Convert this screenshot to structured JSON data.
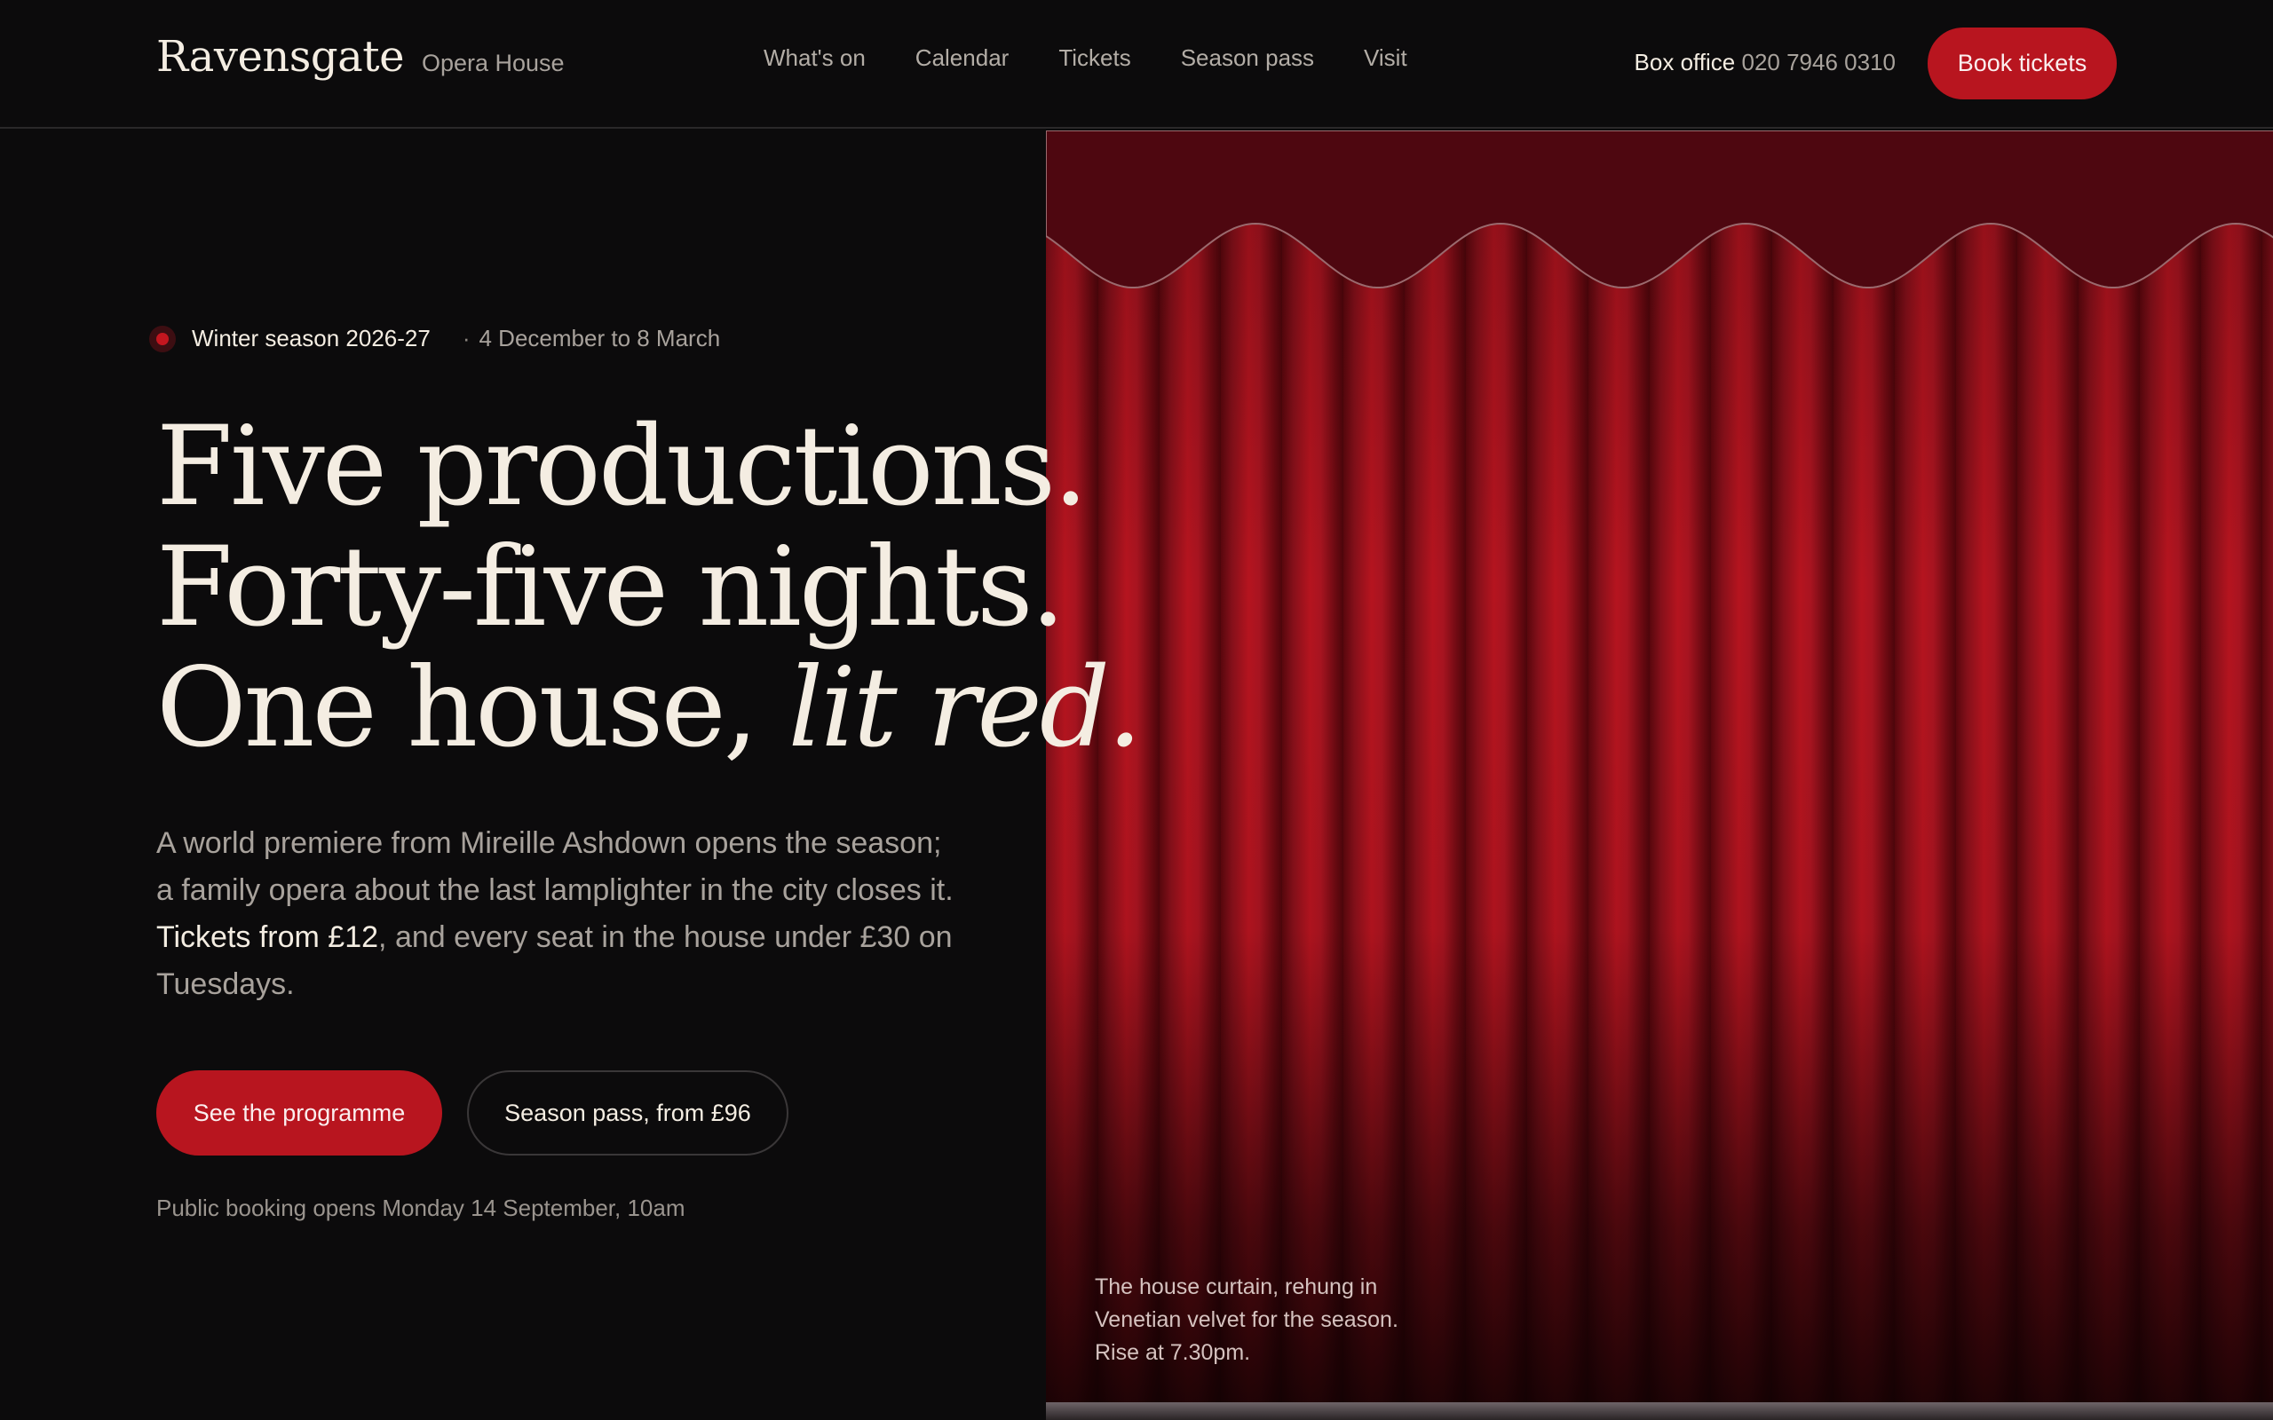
{
  "header": {
    "brand_name": "Ravensgate",
    "brand_sub": "Opera House",
    "nav": [
      "What's on",
      "Calendar",
      "Tickets",
      "Season pass",
      "Visit"
    ],
    "box_office_label": "Box office",
    "box_office_phone": "020 7946 0310",
    "book_label": "Book tickets"
  },
  "hero": {
    "season_name": "Winter season 2026-27",
    "season_separator": "·",
    "season_dates": "4 December to 8 March",
    "headline_1": "Five productions.",
    "headline_2": "Forty-five nights.",
    "headline_3a": "One house, ",
    "headline_3b": "lit red.",
    "lede_1": "A world premiere from Mireille Ashdown opens the season; a family opera about the last lamplighter in the city closes it. ",
    "lede_strong": "Tickets from £12",
    "lede_2": ", and every seat in the house under £30 on Tuesdays.",
    "primary_cta": "See the programme",
    "secondary_cta": "Season pass, from £96",
    "booking_note": "Public booking opens Monday 14 September, 10am"
  },
  "curtain": {
    "caption": "The house curtain, rehung in Venetian velvet for the season. Rise at 7.30pm."
  },
  "colors": {
    "background": "#0c0b0c",
    "accent": "#b8151f",
    "text": "#f4ede2",
    "muted": "#a8a29c"
  }
}
